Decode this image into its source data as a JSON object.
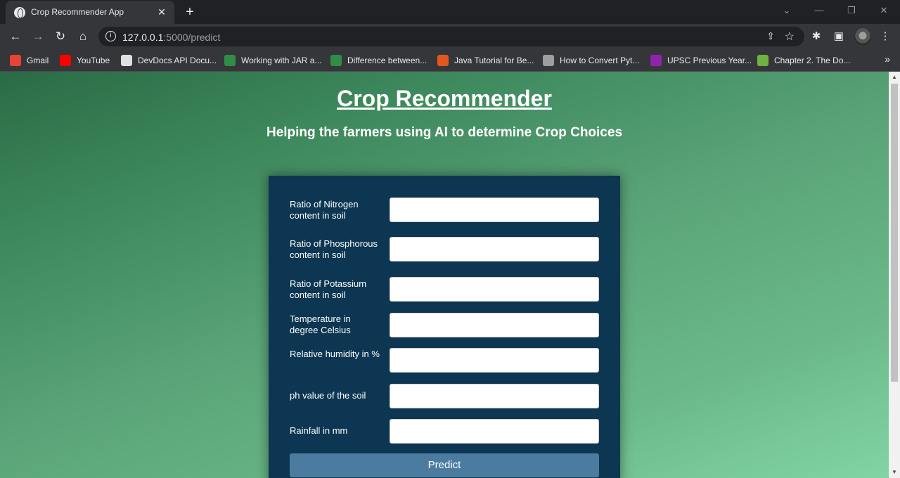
{
  "browser": {
    "tab_title": "Crop Recommender App",
    "new_tab_symbol": "+",
    "url_host": "127.0.0.1",
    "url_path": ":5000/predict",
    "bookmarks": [
      {
        "label": "Gmail",
        "color": "#ea4335"
      },
      {
        "label": "YouTube",
        "color": "#ff0000"
      },
      {
        "label": "DevDocs API Docu...",
        "color": "#e0e0e0"
      },
      {
        "label": "Working with JAR a...",
        "color": "#2f8d46"
      },
      {
        "label": "Difference between...",
        "color": "#2f8d46"
      },
      {
        "label": "Java Tutorial for Be...",
        "color": "#e2571e"
      },
      {
        "label": "How to Convert Pyt...",
        "color": "#9e9e9e"
      },
      {
        "label": "UPSC Previous Year...",
        "color": "#8e24aa"
      },
      {
        "label": "Chapter 2. The Do...",
        "color": "#6db33f"
      }
    ],
    "more_bookmarks": "»"
  },
  "page": {
    "title": "Crop Recommender",
    "subtitle": "Helping the farmers using AI to determine Crop Choices",
    "fields": [
      {
        "label": "Ratio of Nitrogen content in soil",
        "value": ""
      },
      {
        "label": "Ratio of Phosphorous content in soil",
        "value": ""
      },
      {
        "label": "Ratio of Potassium content in soil",
        "value": ""
      },
      {
        "label": "Temperature in degree Celsius",
        "value": ""
      },
      {
        "label": "Relative humidity in %",
        "value": ""
      },
      {
        "label": "ph value of the soil",
        "value": ""
      },
      {
        "label": "Rainfall in mm",
        "value": ""
      }
    ],
    "submit_label": "Predict"
  },
  "colors": {
    "page_gradient_start": "#2a6b45",
    "page_gradient_end": "#82d4a4",
    "card_background": "#0c3651",
    "button_background": "#4c7ba0"
  }
}
